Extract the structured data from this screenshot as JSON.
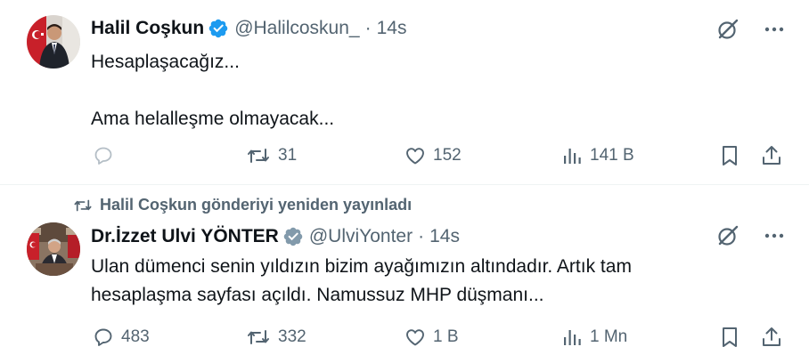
{
  "tweets": [
    {
      "name": "Halil Coşkun",
      "handle": "@Halilcoskun_",
      "separator": "·",
      "time": "14s",
      "lines": [
        "Hesaplaşacağız...",
        "",
        "Ama helalleşme olmayacak..."
      ],
      "replies": "",
      "reposts": "31",
      "likes": "152",
      "views": "141 B"
    },
    {
      "repost_notice": "Halil Coşkun gönderiyi yeniden yayınladı",
      "name": "Dr.İzzet Ulvi YÖNTER",
      "handle": "@UlviYonter",
      "separator": "·",
      "time": "14s",
      "lines": [
        "Ulan dümenci senin yıldızın bizim ayağımızın altındadır. Artık tam",
        "hesaplaşma sayfası açıldı. Namussuz MHP düşmanı..."
      ],
      "replies": "483",
      "reposts": "332",
      "likes": "1 B",
      "views": "1 Mn"
    }
  ],
  "colors": {
    "verified": "#1d9bf0",
    "muted": "#536471",
    "text": "#0f1419",
    "divider": "#eff3f4"
  }
}
